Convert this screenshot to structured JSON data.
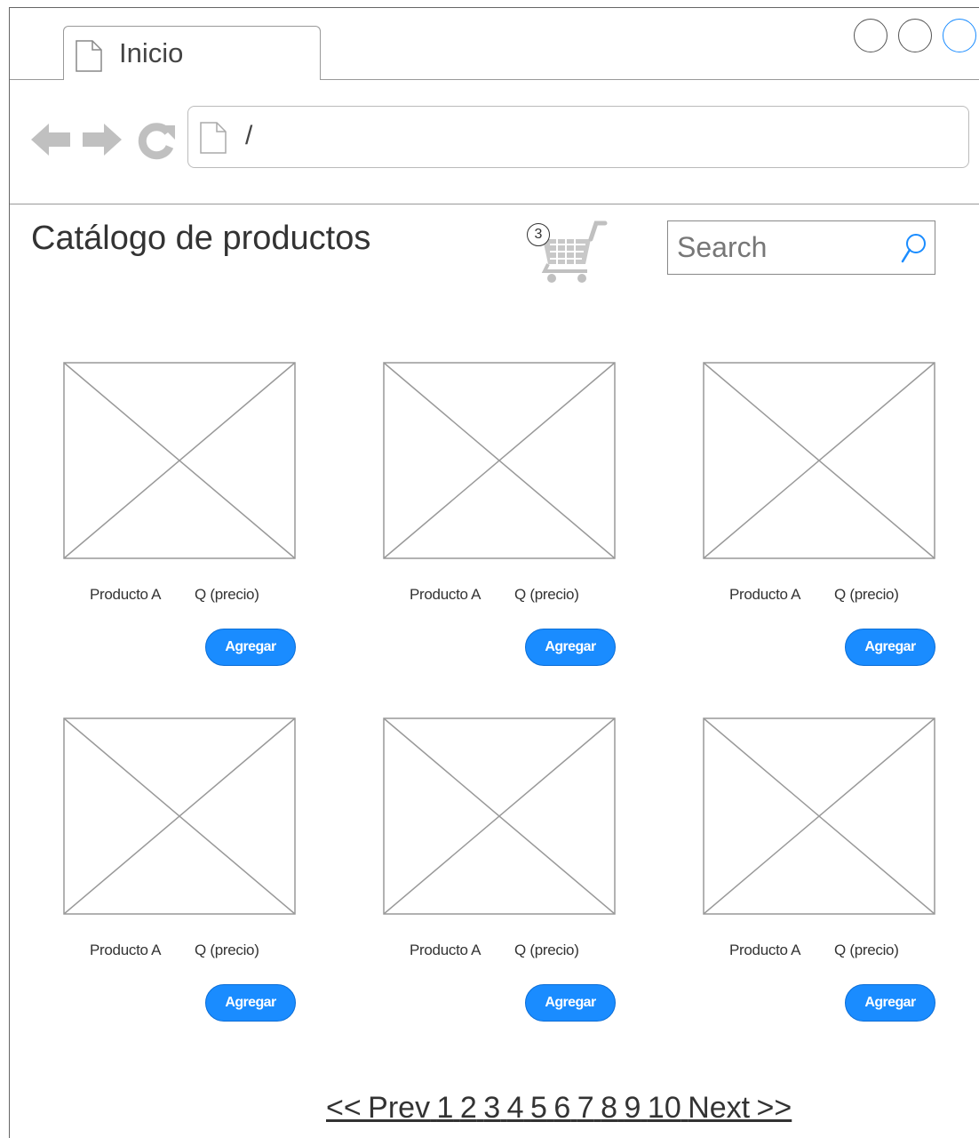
{
  "browser": {
    "tab_label": "Inicio",
    "address_text": "/"
  },
  "page": {
    "title": "Catálogo de productos",
    "cart_count": "3",
    "search_placeholder": "Search"
  },
  "products": [
    {
      "name": "Producto A",
      "price": "Q (precio)",
      "button": "Agregar"
    },
    {
      "name": "Producto A",
      "price": "Q (precio)",
      "button": "Agregar"
    },
    {
      "name": "Producto A",
      "price": "Q (precio)",
      "button": "Agregar"
    },
    {
      "name": "Producto A",
      "price": "Q (precio)",
      "button": "Agregar"
    },
    {
      "name": "Producto A",
      "price": "Q (precio)",
      "button": "Agregar"
    },
    {
      "name": "Producto A",
      "price": "Q (precio)",
      "button": "Agregar"
    }
  ],
  "pagination": {
    "prev": "<< Prev",
    "pages": [
      "1",
      "2",
      "3",
      "4",
      "5",
      "6",
      "7",
      "8",
      "9",
      "10"
    ],
    "next": "Next >>"
  },
  "colors": {
    "accent": "#1a8cff",
    "icon_gray": "#c0c0c0"
  }
}
